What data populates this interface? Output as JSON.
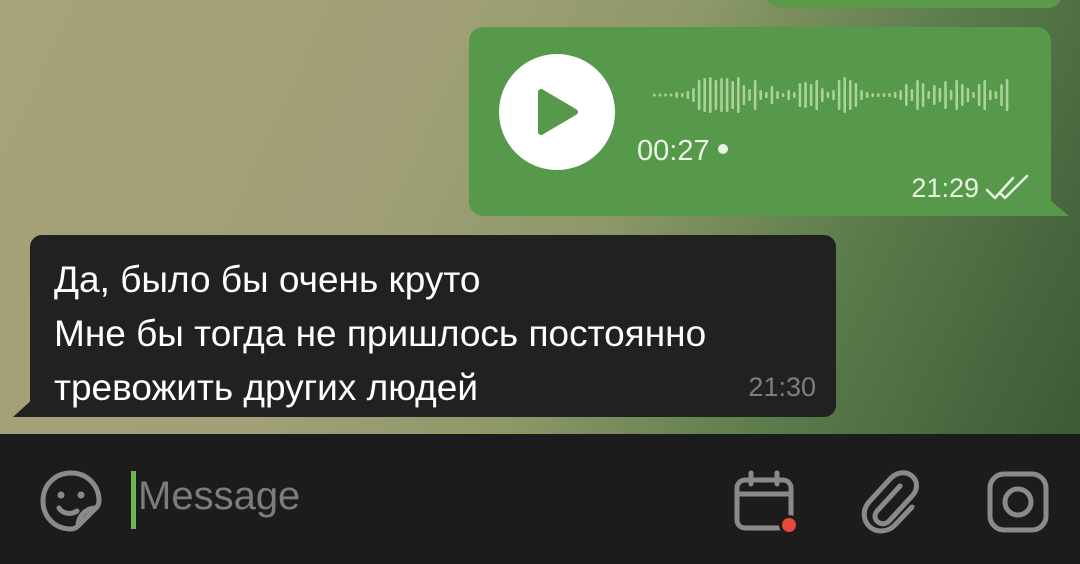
{
  "outgoing_voice": {
    "duration": "00:27",
    "time": "21:29"
  },
  "incoming_message": {
    "text": "Да, было бы очень круто\nМне бы тогда не пришлось постоянно\nтревожить других людей",
    "time": "21:30"
  },
  "composer": {
    "placeholder": "Message"
  },
  "colors": {
    "outgoing_bubble": "#57994a",
    "incoming_bubble": "#212121",
    "accent": "#6cb950",
    "notification_dot": "#e5483d"
  }
}
